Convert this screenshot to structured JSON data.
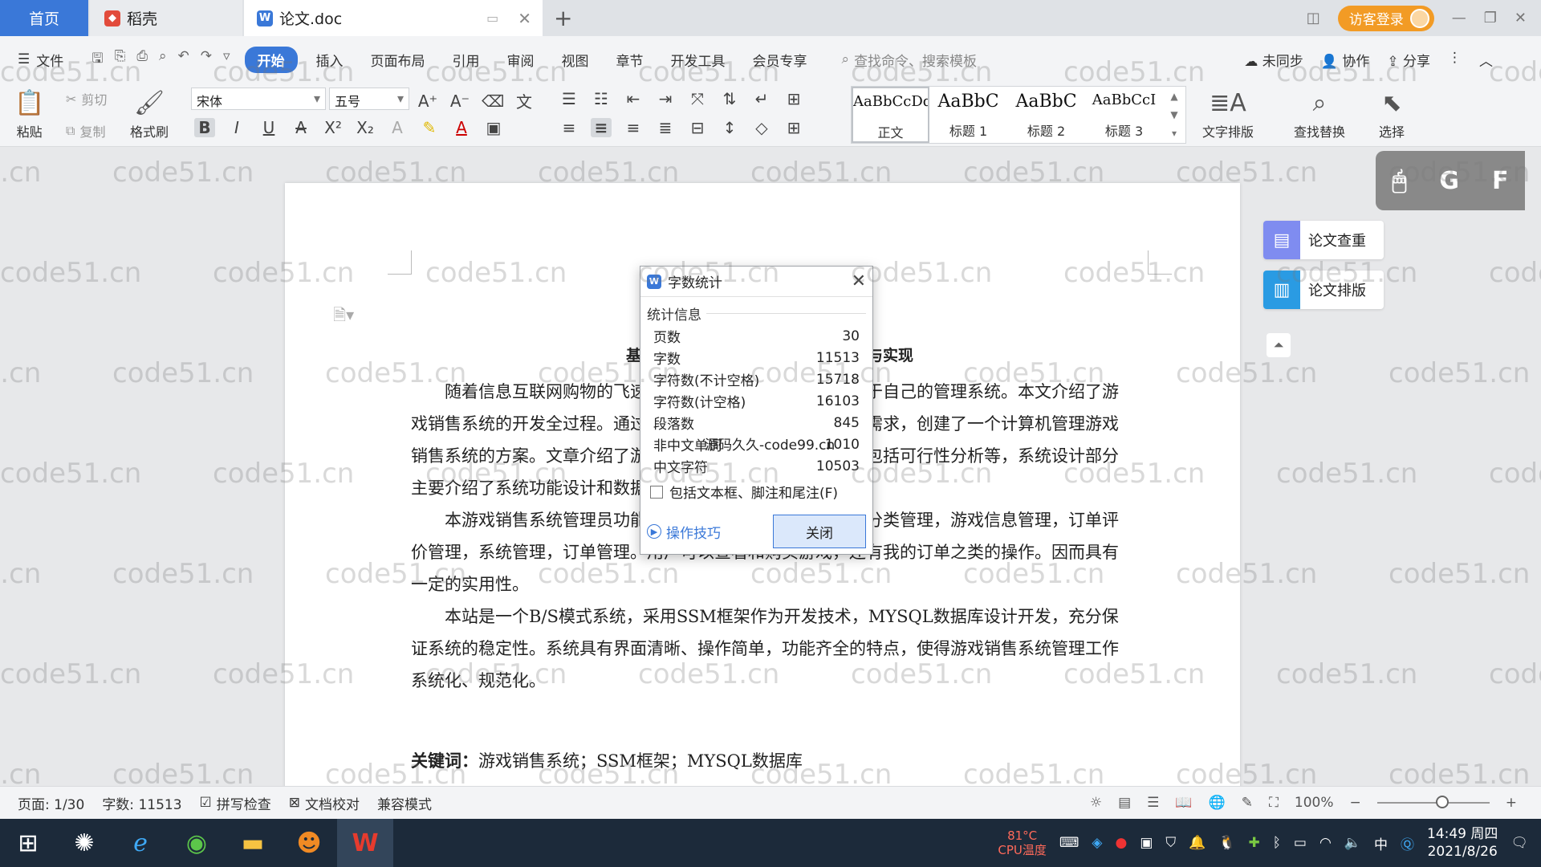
{
  "tabs": {
    "home": "首页",
    "daoke": "稻壳",
    "doc": "论文.doc",
    "add": "+"
  },
  "titlebar": {
    "login": "访客登录"
  },
  "menu": {
    "file": "文件",
    "items": [
      "开始",
      "插入",
      "页面布局",
      "引用",
      "审阅",
      "视图",
      "章节",
      "开发工具",
      "会员专享"
    ],
    "search_placeholder": "查找命令、搜索模板",
    "sync": "未同步",
    "collab": "协作",
    "share": "分享"
  },
  "ribbon": {
    "paste": "粘贴",
    "cut": "剪切",
    "copy": "复制",
    "format_painter": "格式刷",
    "font_name": "宋体",
    "font_size": "五号",
    "styles": [
      {
        "preview": "AaBbCcDd",
        "name": "正文"
      },
      {
        "preview": "AaBbC",
        "name": "标题 1"
      },
      {
        "preview": "AaBbC",
        "name": "标题 2"
      },
      {
        "preview": "AaBbCcI",
        "name": "标题 3"
      }
    ],
    "text_layout": "文字排版",
    "find_replace": "查找替换",
    "select": "选择"
  },
  "document": {
    "title_left": "基",
    "title_right": "与实现",
    "p1": "随着信息互联网购物的飞速发展，一般企业都采用构建属于自己的管理系统。本文介绍了游戏销售系统的开发全过程。通过分析企业对于游戏销售系统的需求，创建了一个计算机管理游戏销售系统的方案。文章介绍了游戏销售系统的系统分析部分，包括可行性分析等，系统设计部分主要介绍了系统功能设计和数据库设计。",
    "p2": "本游戏销售系统管理员功能有个人中心，用户管理，游戏分类管理，游戏信息管理，订单评价管理，系统管理，订单管理。用户可以查看和购买游戏，还有我的订单之类的操作。因而具有一定的实用性。",
    "p3": "本站是一个B/S模式系统，采用SSM框架作为开发技术，MYSQL数据库设计开发，充分保证系统的稳定性。系统具有界面清晰、操作简单，功能齐全的特点，使得游戏销售系统管理工作系统化、规范化。",
    "keywords_label": "关键词：",
    "keywords": "游戏销售系统；SSM框架；MYSQL数据库"
  },
  "side_panel": {
    "check": "论文查重",
    "layout": "论文排版"
  },
  "float_toolbar": {
    "g": "G",
    "f": "F"
  },
  "dialog": {
    "title": "字数统计",
    "section": "统计信息",
    "stats": [
      {
        "label": "页数",
        "value": "30"
      },
      {
        "label": "字数",
        "value": "11513"
      },
      {
        "label": "字符数(不计空格)",
        "value": "15718"
      },
      {
        "label": "字符数(计空格)",
        "value": "16103"
      },
      {
        "label": "段落数",
        "value": "845"
      },
      {
        "label": "非中文单词",
        "value": "1010"
      },
      {
        "label": "中文字符",
        "value": "10503"
      }
    ],
    "checkbox": "包括文本框、脚注和尾注(F)",
    "tips": "操作技巧",
    "close": "关闭",
    "overlay": "源码久久-code99.cn"
  },
  "watermark_text": "code51.cn",
  "statusbar": {
    "page": "页面: 1/30",
    "words": "字数: 11513",
    "spell": "拼写检查",
    "proof": "文档校对",
    "compat": "兼容模式",
    "zoom": "100%",
    "zoom_fraction": 0.58
  },
  "taskbar": {
    "temp": "81°C",
    "cpu": "CPU温度",
    "time": "14:49 周四",
    "date": "2021/8/26",
    "ime": "中"
  }
}
